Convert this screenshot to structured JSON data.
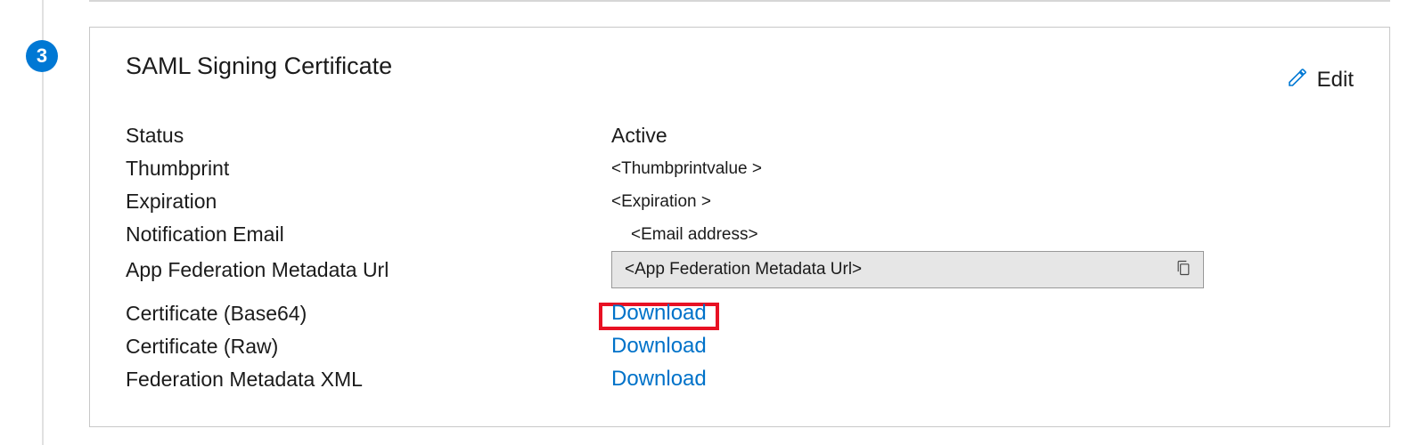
{
  "step": {
    "number": "3"
  },
  "card": {
    "title": "SAML Signing Certificate",
    "editLabel": "Edit"
  },
  "fields": {
    "status": {
      "label": "Status",
      "value": "Active"
    },
    "thumbprint": {
      "label": "Thumbprint",
      "value": "<Thumbprintvalue >"
    },
    "expiration": {
      "label": "Expiration",
      "value": "<Expiration >"
    },
    "notificationEmail": {
      "label": "Notification Email",
      "value": "<Email address>"
    },
    "metadataUrl": {
      "label": "App Federation Metadata Url",
      "value": "<App Federation  Metadata Url>"
    },
    "certBase64": {
      "label": "Certificate (Base64)",
      "action": "Download"
    },
    "certRaw": {
      "label": "Certificate (Raw)",
      "action": "Download"
    },
    "fedXml": {
      "label": "Federation Metadata XML",
      "action": "Download"
    }
  }
}
